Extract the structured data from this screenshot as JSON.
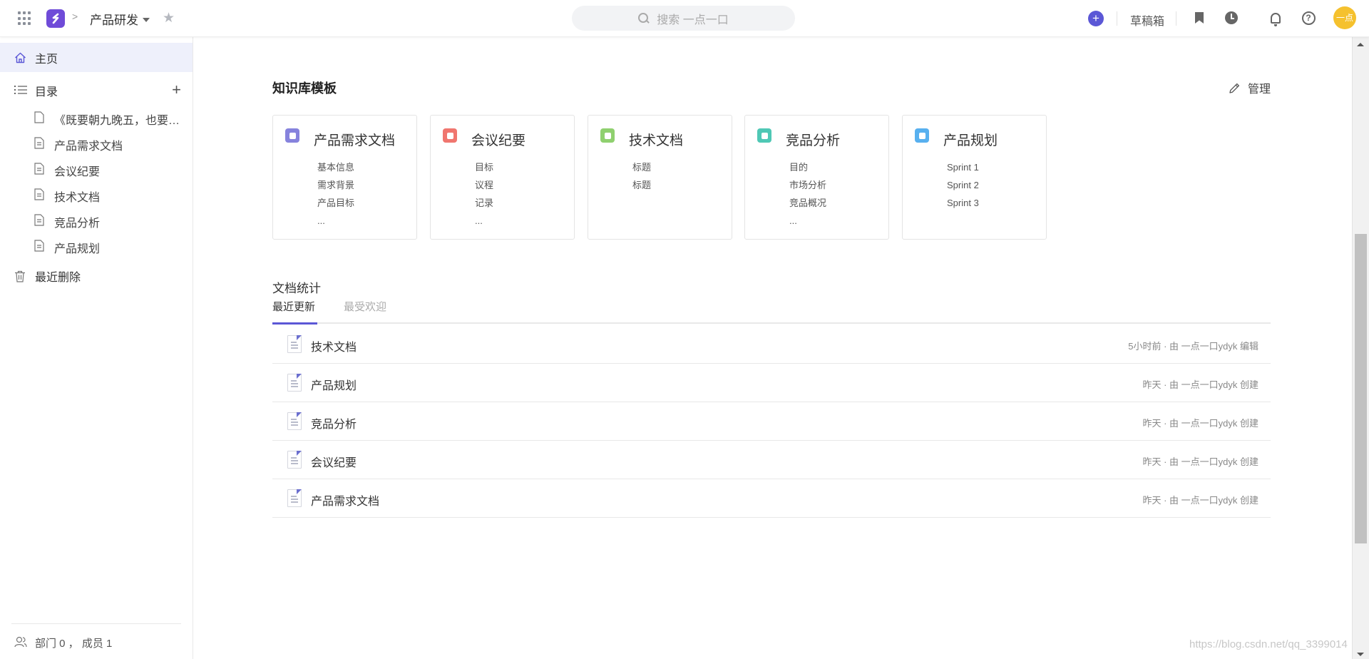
{
  "header": {
    "space_name": "产品研发",
    "breadcrumb_separator": ">",
    "search_placeholder": "搜索 一点一口",
    "drafts_label": "草稿箱",
    "avatar_text": "一点",
    "colors": {
      "brand": "#6f4bd8",
      "accent": "#5b57d6",
      "avatar": "#f5c12e"
    }
  },
  "sidebar": {
    "home_label": "主页",
    "catalog_label": "目录",
    "tree": [
      {
        "label": "《既要朝九晚五，也要…"
      },
      {
        "label": "产品需求文档"
      },
      {
        "label": "会议纪要"
      },
      {
        "label": "技术文档"
      },
      {
        "label": "竞品分析"
      },
      {
        "label": "产品规划"
      }
    ],
    "trash_label": "最近删除",
    "footer_label": "部门 0 ， 成员 1"
  },
  "main": {
    "kb_title": "知识库模板",
    "manage_label": "管理",
    "templates": [
      {
        "name": "产品需求文档",
        "color": "#8683dd",
        "lines": [
          "基本信息",
          "需求背景",
          "产品目标",
          "..."
        ]
      },
      {
        "name": "会议纪要",
        "color": "#f0766f",
        "lines": [
          "目标",
          "议程",
          "记录",
          "..."
        ]
      },
      {
        "name": "技术文档",
        "color": "#8fd06f",
        "lines": [
          "标题",
          "标题"
        ]
      },
      {
        "name": "竞品分析",
        "color": "#4fc8b5",
        "lines": [
          "目的",
          "市场分析",
          "竞品概况",
          "..."
        ]
      },
      {
        "name": "产品规划",
        "color": "#58b0ef",
        "lines": [
          "Sprint 1",
          "Sprint 2",
          "Sprint 3"
        ]
      }
    ],
    "stats_title": "文档统计",
    "tabs": [
      {
        "label": "最近更新",
        "active": true
      },
      {
        "label": "最受欢迎",
        "active": false
      }
    ],
    "docs": [
      {
        "name": "技术文档",
        "meta": "5小时前 · 由 一点一口ydyk 编辑"
      },
      {
        "name": "产品规划",
        "meta": "昨天 · 由 一点一口ydyk 创建"
      },
      {
        "name": "竞品分析",
        "meta": "昨天 · 由 一点一口ydyk 创建"
      },
      {
        "name": "会议纪要",
        "meta": "昨天 · 由 一点一口ydyk 创建"
      },
      {
        "name": "产品需求文档",
        "meta": "昨天 · 由 一点一口ydyk 创建"
      }
    ]
  },
  "watermark": "https://blog.csdn.net/qq_3399014"
}
